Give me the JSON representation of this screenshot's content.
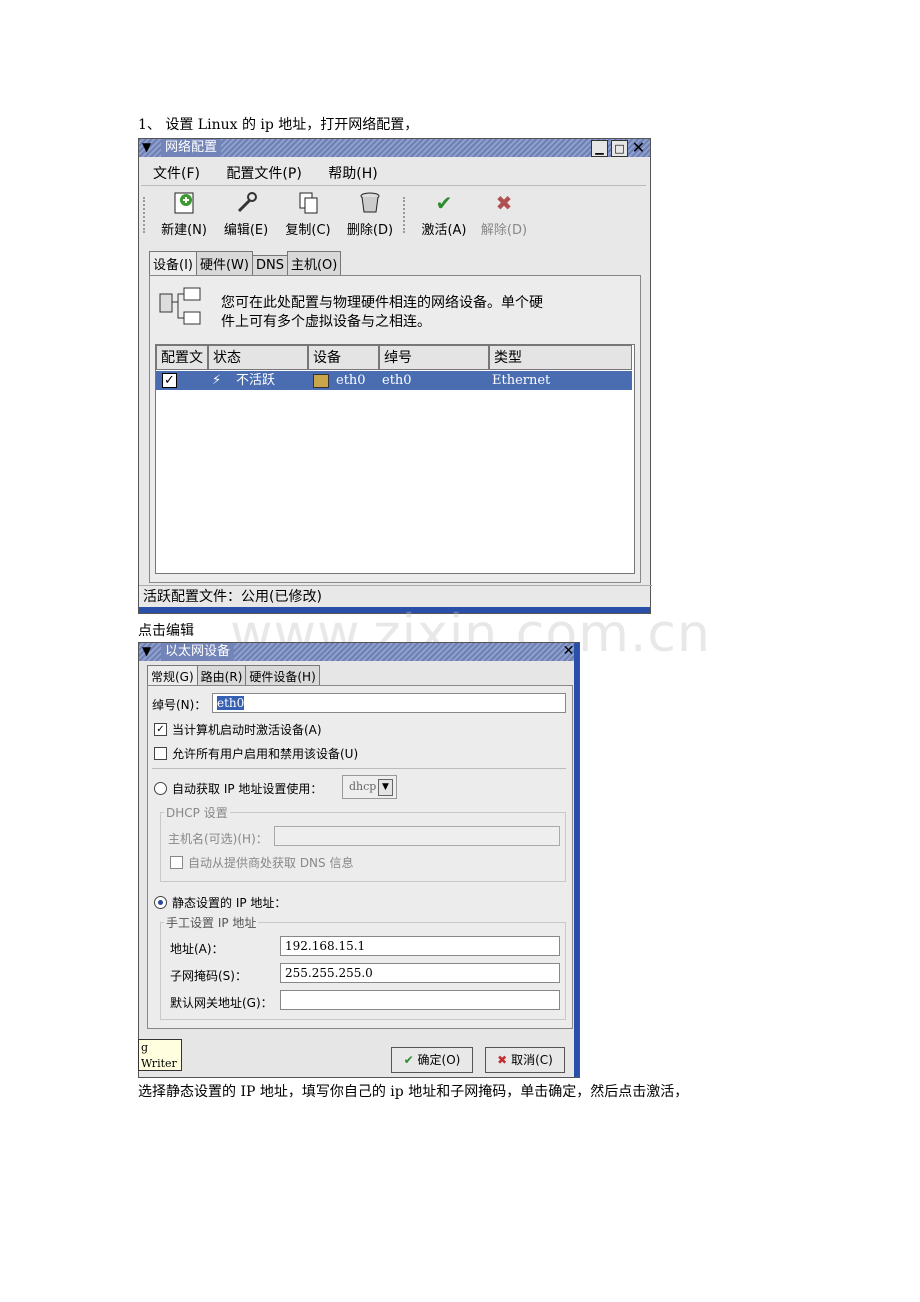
{
  "doc": {
    "line1": "1、  设置 Linux 的 ip 地址，打开网络配置，",
    "line2": "点击编辑",
    "line3": "选择静态设置的 IP 地址，填写你自己的 ip 地址和子网掩码，单击确定，然后点击激活，",
    "watermark": "www.zixin.com.cn"
  },
  "win1": {
    "title": "网络配置",
    "menu": [
      "文件(F)",
      "配置文件(P)",
      "帮助(H)"
    ],
    "menu_keys": [
      "F",
      "P",
      "H"
    ],
    "toolbar": [
      {
        "label": "新建(N)",
        "icon": "new-plus-icon"
      },
      {
        "label": "编辑(E)",
        "icon": "wrench-icon"
      },
      {
        "label": "复制(C)",
        "icon": "copy-icon"
      },
      {
        "label": "删除(D)",
        "icon": "trash-icon"
      },
      {
        "label": "激活(A)",
        "icon": "check-icon"
      },
      {
        "label": "解除(D)",
        "icon": "x-icon"
      }
    ],
    "tabs": [
      "设备(I)",
      "硬件(W)",
      "DNS",
      "主机(O)"
    ],
    "info_line1": "您可在此处配置与物理硬件相连的网络设备。单个硬",
    "info_line2": "件上可有多个虚拟设备与之相连。",
    "columns": [
      "配置文",
      "状态",
      "设备",
      "绰号",
      "类型"
    ],
    "rows": [
      {
        "checked": true,
        "status": "不活跃",
        "device": "eth0",
        "nickname": "eth0",
        "type": "Ethernet"
      }
    ],
    "statusbar": "活跃配置文件：公用(已修改)"
  },
  "win2": {
    "title": "以太网设备",
    "tabs": [
      "常规(G)",
      "路由(R)",
      "硬件设备(H)"
    ],
    "nickname_label": "绰号(N)：",
    "nickname_value": "eth0",
    "chk_boot": "当计算机启动时激活设备(A)",
    "chk_boot_checked": true,
    "chk_users": "允许所有用户启用和禁用该设备(U)",
    "chk_users_checked": false,
    "radio_auto": "自动获取  IP  地址设置使用：",
    "dhcp_select": "dhcp",
    "dhcp_group": "DHCP  设置",
    "hostname_label": "主机名(可选)(H)：",
    "hostname_value": "",
    "dhcp_dns": "自动从提供商处获取  DNS  信息",
    "radio_static": "静态设置的  IP  地址：",
    "manual_group": "手工设置  IP  地址",
    "addr_label": "地址(A)：",
    "addr_value": "192.168.15.1",
    "mask_label": "子网掩码(S)：",
    "mask_value": "255.255.255.0",
    "gw_label": "默认网关地址(G)：",
    "gw_value": "",
    "ok_label": "确定(O)",
    "cancel_label": "取消(C)",
    "tooltip": "g  Writer"
  }
}
